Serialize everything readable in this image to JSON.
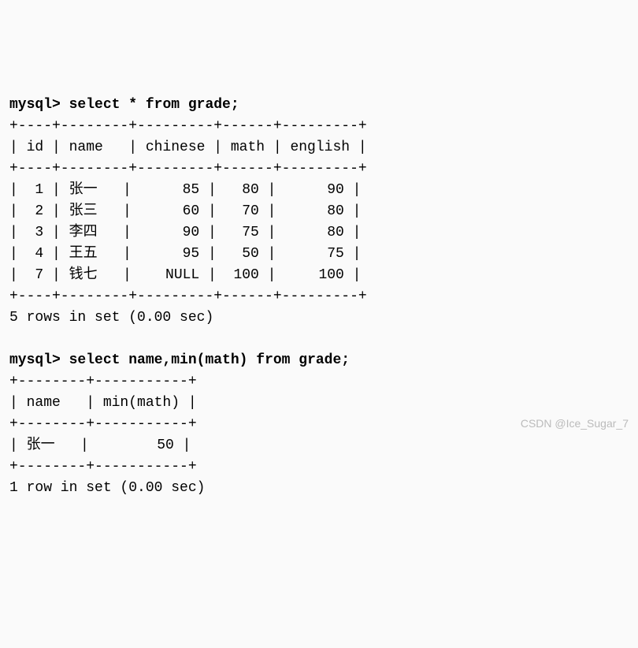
{
  "prompt": "mysql>",
  "query1": {
    "sql": "select * from grade;",
    "border_top": "+----+--------+---------+------+---------+",
    "header_row": "| id | name   | chinese | math | english |",
    "border_mid": "+----+--------+---------+------+---------+",
    "rows": [
      "|  1 | 张一   |      85 |   80 |      90 |",
      "|  2 | 张三   |      60 |   70 |      80 |",
      "|  3 | 李四   |      90 |   75 |      80 |",
      "|  4 | 王五   |      95 |   50 |      75 |",
      "|  7 | 钱七   |    NULL |  100 |     100 |"
    ],
    "border_bot": "+----+--------+---------+------+---------+",
    "status": "5 rows in set (0.00 sec)"
  },
  "query2": {
    "sql": "select name,min(math) from grade;",
    "border_top": "+--------+-----------+",
    "header_row": "| name   | min(math) |",
    "border_mid": "+--------+-----------+",
    "rows": [
      "| 张一   |        50 |"
    ],
    "border_bot": "+--------+-----------+",
    "status": "1 row in set (0.00 sec)"
  },
  "chart_data": [
    {
      "type": "table",
      "title": "grade",
      "columns": [
        "id",
        "name",
        "chinese",
        "math",
        "english"
      ],
      "rows": [
        [
          1,
          "张一",
          85,
          80,
          90
        ],
        [
          2,
          "张三",
          60,
          70,
          80
        ],
        [
          3,
          "李四",
          90,
          75,
          80
        ],
        [
          4,
          "王五",
          95,
          50,
          75
        ],
        [
          7,
          "钱七",
          null,
          100,
          100
        ]
      ]
    },
    {
      "type": "table",
      "title": "min(math)",
      "columns": [
        "name",
        "min(math)"
      ],
      "rows": [
        [
          "张一",
          50
        ]
      ]
    }
  ],
  "watermark": "CSDN @Ice_Sugar_7"
}
